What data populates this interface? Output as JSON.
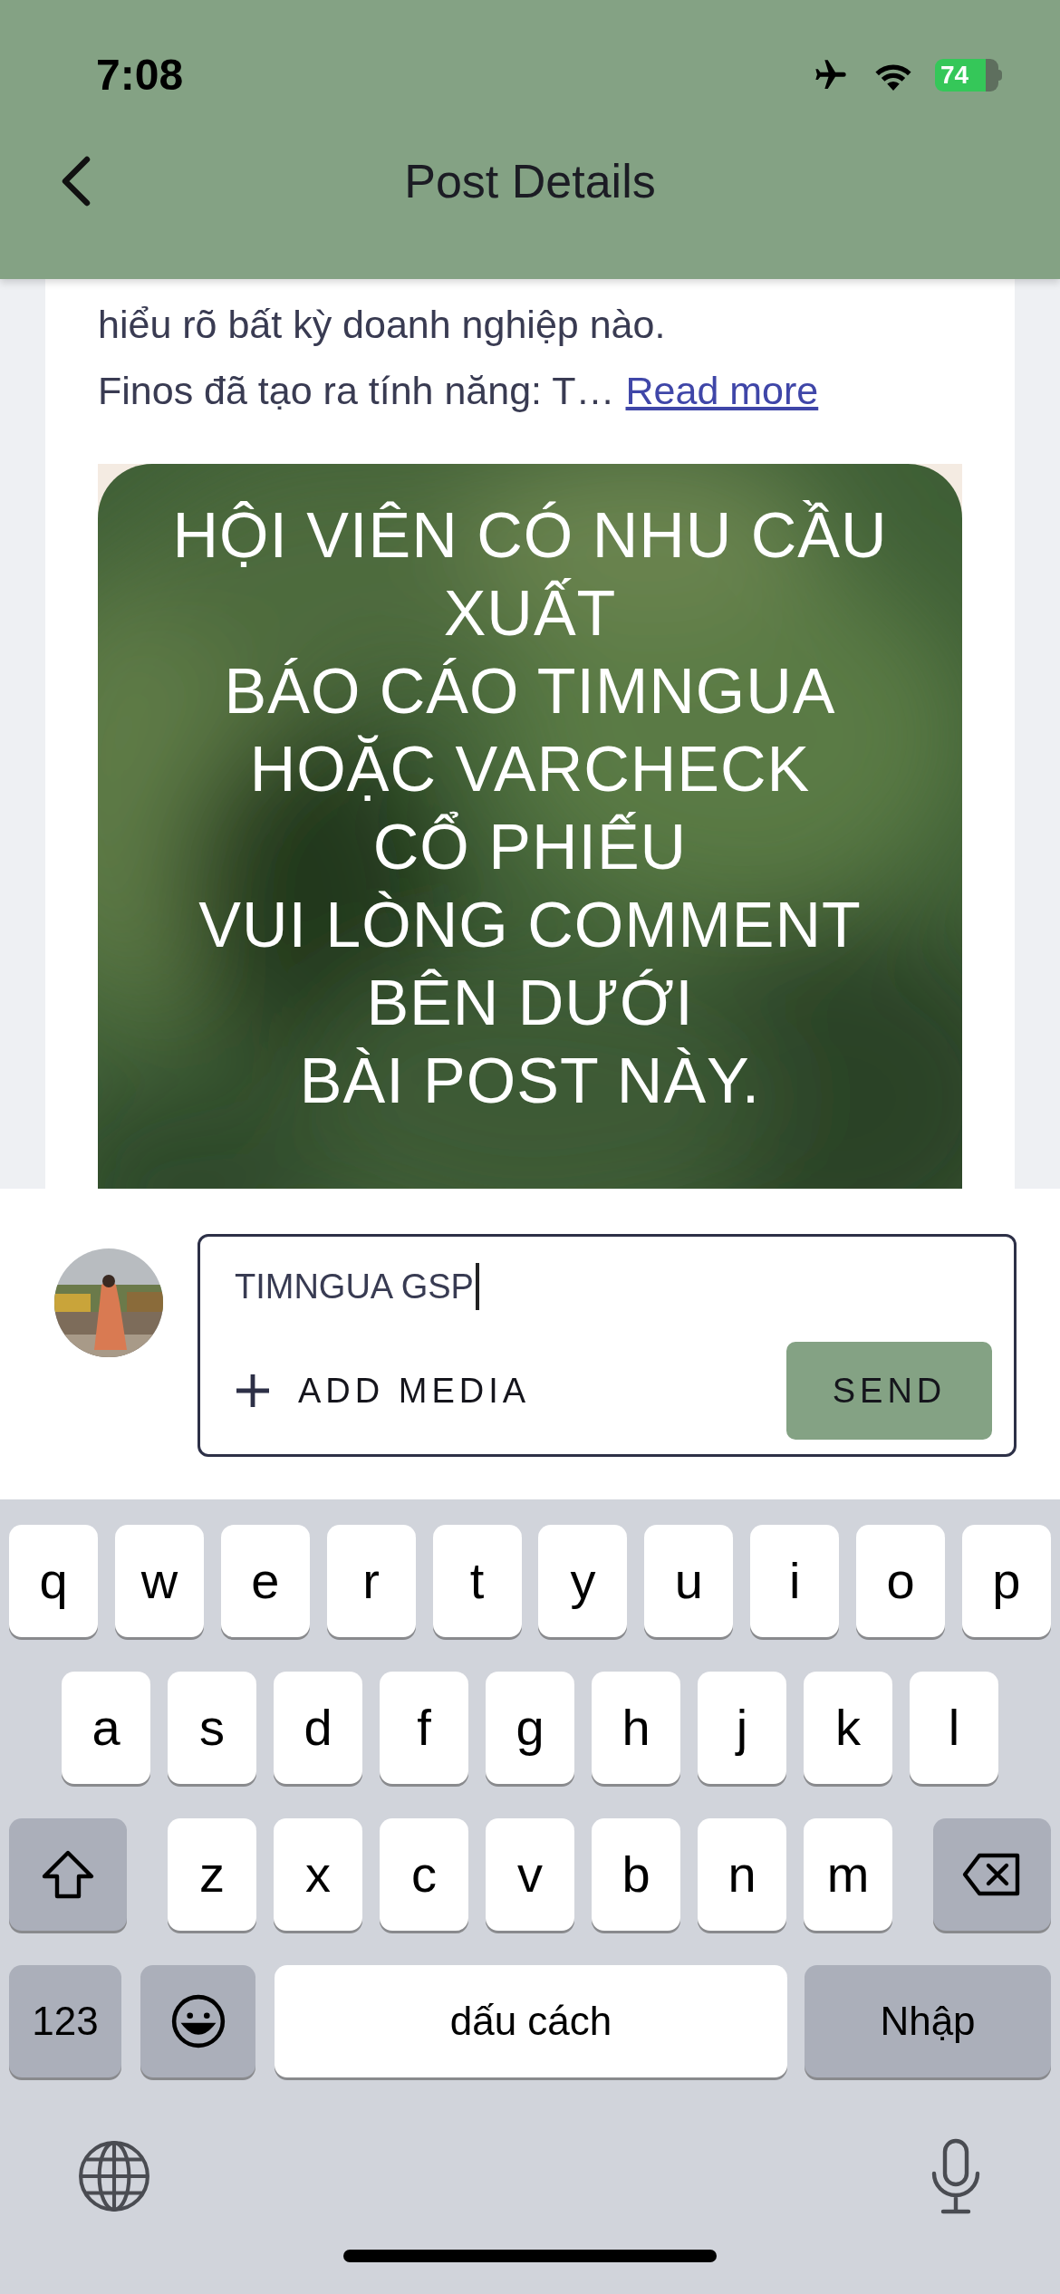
{
  "status_bar": {
    "time": "7:08",
    "battery": "74"
  },
  "header": {
    "title": "Post Details"
  },
  "post": {
    "text_lines": [
      "hiểu rõ bất kỳ doanh nghiệp nào.",
      "Finos đã tạo ra tính năng: T…"
    ],
    "read_more": "Read more",
    "image": {
      "caption_lines": [
        "HỘI VIÊN CÓ NHU CẦU",
        "XUẤT",
        "BÁO CÁO TIMNGUA",
        "HOẶC VARCHECK",
        "CỔ PHIẾU",
        "VUI LÒNG COMMENT",
        "BÊN DƯỚI",
        "BÀI POST NÀY."
      ]
    }
  },
  "comment": {
    "value": "TIMNGUA GSP",
    "add_media": "ADD MEDIA",
    "send": "SEND"
  },
  "keyboard": {
    "letter_rows": [
      [
        {
          "kind": "letter",
          "label": "q"
        },
        {
          "kind": "letter",
          "label": "w"
        },
        {
          "kind": "letter",
          "label": "e"
        },
        {
          "kind": "letter",
          "label": "r"
        },
        {
          "kind": "letter",
          "label": "t"
        },
        {
          "kind": "letter",
          "label": "y"
        },
        {
          "kind": "letter",
          "label": "u"
        },
        {
          "kind": "letter",
          "label": "i"
        },
        {
          "kind": "letter",
          "label": "o"
        },
        {
          "kind": "letter",
          "label": "p"
        }
      ],
      [
        {
          "kind": "letter",
          "label": "a"
        },
        {
          "kind": "letter",
          "label": "s"
        },
        {
          "kind": "letter",
          "label": "d"
        },
        {
          "kind": "letter",
          "label": "f"
        },
        {
          "kind": "letter",
          "label": "g"
        },
        {
          "kind": "letter",
          "label": "h"
        },
        {
          "kind": "letter",
          "label": "j"
        },
        {
          "kind": "letter",
          "label": "k"
        },
        {
          "kind": "letter",
          "label": "l"
        }
      ],
      [
        {
          "kind": "shift"
        },
        {
          "kind": "letter",
          "label": "z"
        },
        {
          "kind": "letter",
          "label": "x"
        },
        {
          "kind": "letter",
          "label": "c"
        },
        {
          "kind": "letter",
          "label": "v"
        },
        {
          "kind": "letter",
          "label": "b"
        },
        {
          "kind": "letter",
          "label": "n"
        },
        {
          "kind": "letter",
          "label": "m"
        },
        {
          "kind": "backspace"
        }
      ]
    ],
    "bottom_keys": [
      {
        "kind": "mode",
        "label": "123"
      },
      {
        "kind": "emoji"
      },
      {
        "kind": "space",
        "label": "dấu cách"
      },
      {
        "kind": "return",
        "label": "Nhập"
      }
    ]
  }
}
